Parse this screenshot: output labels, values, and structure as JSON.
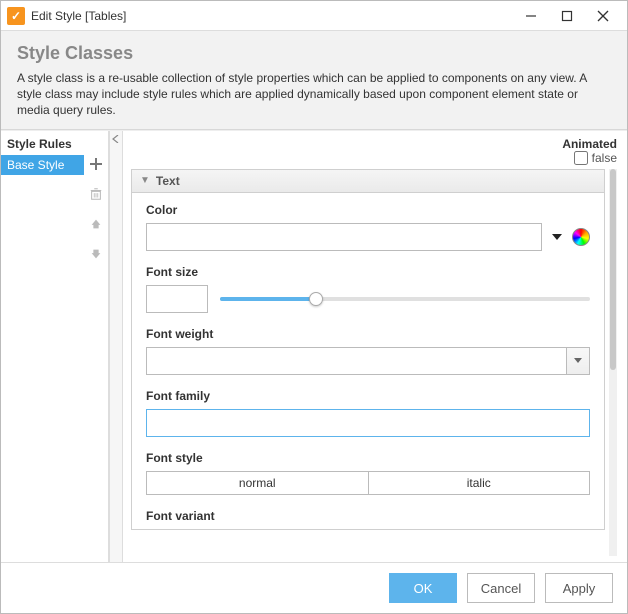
{
  "titlebar": {
    "title": "Edit Style [Tables]"
  },
  "header": {
    "heading": "Style Classes",
    "description": "A style class is a re-usable collection of style properties which can be applied to components on any view. A style class may include style rules which are applied dynamically based upon component element state or media query rules."
  },
  "sidebar": {
    "label": "Style Rules",
    "items": [
      "Base Style"
    ]
  },
  "right": {
    "animated_label": "Animated",
    "animated_value": "false",
    "section_title": "Text",
    "fields": {
      "color_label": "Color",
      "font_size_label": "Font size",
      "font_weight_label": "Font weight",
      "font_family_label": "Font family",
      "font_style_label": "Font style",
      "font_style_options": [
        "normal",
        "italic"
      ],
      "font_variant_label": "Font variant"
    }
  },
  "footer": {
    "ok": "OK",
    "cancel": "Cancel",
    "apply": "Apply"
  }
}
